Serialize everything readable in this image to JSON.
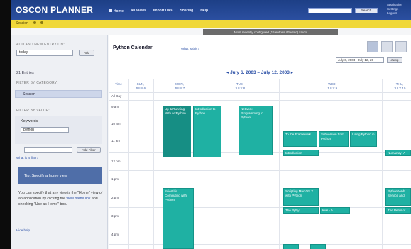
{
  "app": {
    "title": "OSCON PLANNER",
    "nav": [
      "Home",
      "All Views",
      "Import Data",
      "Sharing",
      "Help"
    ],
    "search_button": "Search",
    "user_links": [
      "Application",
      "Settings",
      "Logout"
    ]
  },
  "subbar": {
    "label": "Session"
  },
  "notice": "Most recently configured (16 entries affected) Undo",
  "sidebar": {
    "add_header": "Add and new entry on:",
    "add_value": "today",
    "add_button": "Add",
    "entries_count": "21 Entries",
    "filter_category_header": "Filter by category:",
    "category_item": "Session",
    "filter_value_header": "Filter by value:",
    "keywords_label": "Keywords",
    "keywords_value": "python",
    "add_filter_button": "Add Filter",
    "what_filter_link": "What is a filter?",
    "tip_title": "Tip: Specify a home view",
    "tip_text_1": "You can specify that any view is the \"Home\" view of an application by clicking the",
    "tip_link": "view name link",
    "tip_text_2": "and checking \"Use as Home\" box.",
    "hide_help": "Hide help"
  },
  "calendar": {
    "title": "Python Calendar",
    "what_link": "What is this?",
    "date_range": "July 6, 2003 - July 12, 20",
    "jump_button": "Jump",
    "week_nav": "◂ July 6, 2003 – July 12, 2003 ▸",
    "time_header": "Time",
    "all_day": "All Day",
    "days": [
      {
        "name": "SUN,",
        "date": "JULY 6"
      },
      {
        "name": "MON,",
        "date": "JULY 7"
      },
      {
        "name": "TUE,",
        "date": "JULY 8"
      },
      {
        "name": "WED,",
        "date": "JULY 9"
      },
      {
        "name": "THU,",
        "date": "JULY 10"
      }
    ],
    "times": [
      "9 am",
      "10 am",
      "11 am",
      "12 pm",
      "1 pm",
      "2 pm",
      "3 pm",
      "4 pm"
    ],
    "events": [
      {
        "title": "Up & Running With wxPython"
      },
      {
        "title": "Introduction to Python"
      },
      {
        "title": "Network Programming in Python"
      },
      {
        "title": "To the Framework"
      },
      {
        "title": "Subversion from Python"
      },
      {
        "title": "Using Python in"
      },
      {
        "title": "Introduction"
      },
      {
        "title": "Numarray: A"
      },
      {
        "title": "Scientific Computing with Python"
      },
      {
        "title": "Scripting Mac OS X with Python"
      },
      {
        "title": "The PyPy"
      },
      {
        "title": "Kiwi - A"
      },
      {
        "title": "Python Web Service and"
      },
      {
        "title": "The Perils of"
      }
    ]
  }
}
